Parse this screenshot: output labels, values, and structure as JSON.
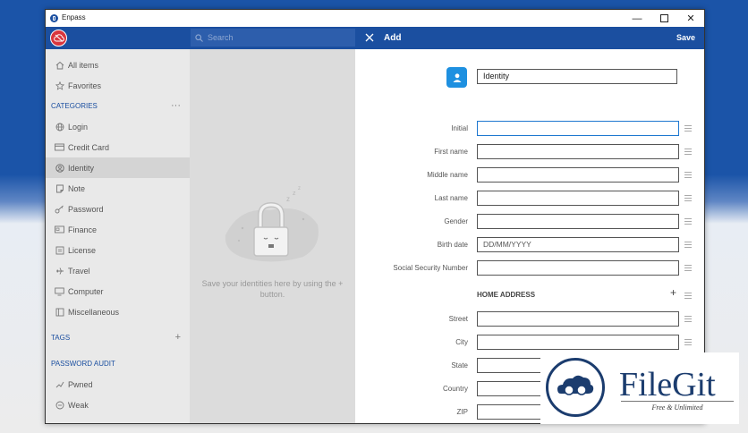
{
  "window": {
    "title": "Enpass"
  },
  "toolbar": {
    "search_placeholder": "Search",
    "add_title": "Add",
    "save_label": "Save"
  },
  "sidebar": {
    "top_items": [
      {
        "label": "All items"
      },
      {
        "label": "Favorites"
      }
    ],
    "categories_header": "CATEGORIES",
    "categories_more": "···",
    "categories": [
      {
        "label": "Login"
      },
      {
        "label": "Credit Card"
      },
      {
        "label": "Identity"
      },
      {
        "label": "Note"
      },
      {
        "label": "Password"
      },
      {
        "label": "Finance"
      },
      {
        "label": "License"
      },
      {
        "label": "Travel"
      },
      {
        "label": "Computer"
      },
      {
        "label": "Miscellaneous"
      }
    ],
    "selected": "Identity",
    "tags_header": "TAGS",
    "tags_add": "+",
    "audit_header": "PASSWORD AUDIT",
    "audit_items": [
      {
        "label": "Pwned"
      },
      {
        "label": "Weak"
      }
    ]
  },
  "middle": {
    "empty_message": "Save your identities here by using the + button."
  },
  "form": {
    "name_value": "Identity",
    "fields": [
      {
        "label": "Initial",
        "value": "",
        "placeholder": ""
      },
      {
        "label": "First name",
        "value": "",
        "placeholder": ""
      },
      {
        "label": "Middle name",
        "value": "",
        "placeholder": ""
      },
      {
        "label": "Last name",
        "value": "",
        "placeholder": ""
      },
      {
        "label": "Gender",
        "value": "",
        "placeholder": ""
      },
      {
        "label": "Birth date",
        "value": "",
        "placeholder": "DD/MM/YYYY"
      },
      {
        "label": "Social Security Number",
        "value": "",
        "placeholder": ""
      }
    ],
    "section_title": "HOME ADDRESS",
    "section_add": "+",
    "address_fields": [
      {
        "label": "Street"
      },
      {
        "label": "City"
      },
      {
        "label": "State"
      },
      {
        "label": "Country"
      },
      {
        "label": "ZIP"
      }
    ]
  },
  "watermark": {
    "name": "FileGit",
    "tagline": "Free & Unlimited"
  },
  "colors": {
    "brand_blue": "#1b4fa0",
    "identity_icon": "#1e90e0",
    "cloud_red": "#d9363e",
    "focus": "#1e78d0"
  }
}
